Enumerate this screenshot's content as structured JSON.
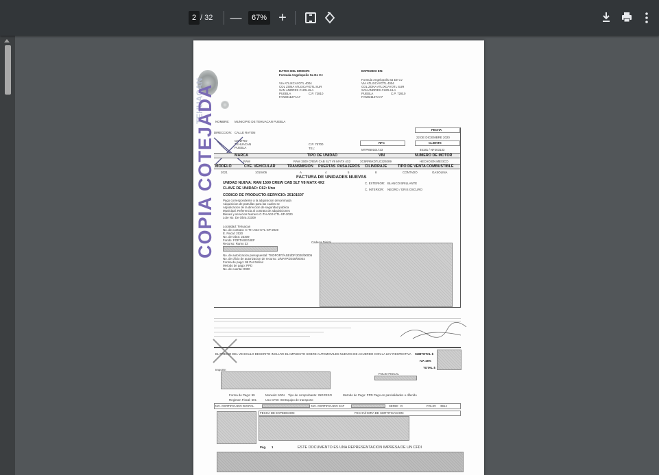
{
  "toolbar": {
    "page_current": "2",
    "page_total": "/ 32",
    "zoom_out": "—",
    "zoom_level": "67%",
    "zoom_in": "+",
    "icons": {
      "fit": "fit-to-page-icon",
      "rotate": "rotate-icon",
      "download": "download-icon",
      "print": "print-icon",
      "more": "more-vert-icon"
    }
  },
  "colors": {
    "toolbar_bg": "#323639",
    "viewer_bg": "#525659",
    "page_bg": "#fdfdfd",
    "stamp_purple": "#7a6bb5"
  },
  "doc": {
    "stamp": "COPIA COTEJADA",
    "emisor_title": "DATOS DEL EMISOR:",
    "emisor_name": "Formula Angelopolis Sa De Cv",
    "emisor_addr1": "VIA ATLIXCAYOTL 4004",
    "emisor_addr2": "COL ZONA ATLIXCAYOTL SUR",
    "emisor_addr3": "SAN ANDRES CHOLULA",
    "emisor_addr4": "PUEBLA",
    "emisor_cp": "C.P. 72810",
    "emisor_rfc": "FAN021127AA7",
    "expedido_title": "EXPEDIDO EN:",
    "expedido_name": "Formula Angelopolis Sa De Cv",
    "expedido_addr1": "VIA ATLIXCAYOTL 4004",
    "expedido_addr2": "COL ZONA ATLIXCAYOTL SUR",
    "expedido_addr3": "SAN ANDRES CHOLULA",
    "expedido_addr4": "PUEBLA",
    "expedido_cp": "C.P. 72810",
    "expedido_rfc": "FAN021127AA7",
    "nombre_label": "NOMBRE:",
    "nombre_value": "MUNICIPIO DE TEHUACAN PUEBLA",
    "direccion_label": "DIRECCION:",
    "direccion_value": "CALLE RAYON",
    "centro": "CENTRO",
    "tehuacan": "TEHUACAN",
    "puebla": "PUEBLA",
    "cp_value": "C.P. 75700",
    "tel_label": "TEL:",
    "fecha_label": "FECHA",
    "fecha_value": "22 DE DICIEMBRE 2020",
    "rfc_label": "RFC",
    "rfc_value": "MTP850101723",
    "cliente_label": "CLIENTE",
    "cliente_value": "45181 / NF203133",
    "hdr_marca": "MARCA",
    "hdr_tipo_unidad": "TIPO DE UNIDAD",
    "hdr_vin": "VIN",
    "hdr_motor": "NUMERO DE MOTOR",
    "val_marca": "RAM",
    "val_tipo_unidad": "RAM 1500 CREW CAB SLT V8 MATX 4X2",
    "val_vin": "3C6RR6KD7LG229289",
    "val_motor": "HECHO EN MEXICO",
    "hdr_modelo": "MODELO",
    "hdr_clave": "CVE. VEHICULAR",
    "hdr_transmision": "TRANSMISION",
    "hdr_puertas": "PUERTAS",
    "hdr_pasajeros": "PASAJEROS",
    "hdr_cilindraje": "CILINDRAJE",
    "hdr_tipo_venta": "TIPO DE VENTA",
    "hdr_combustible": "COMBUSTIBLE",
    "val_modelo": "2021",
    "val_clave": "1010406",
    "val_transmision": "A",
    "val_puertas": "4",
    "val_pasajeros": "5",
    "val_cilindraje": "8",
    "val_tipo_venta": "CONTADO",
    "val_combustible": "GASOLINA",
    "factura_title": "FACTURA DE UNIDADES NUEVAS",
    "unidad_line": "UNIDAD NUEVA: RAM 1500 CREW CAB SLT V8 MATX 4X2",
    "clave_unidad_line": "CLAVE DE UNIDAD:   C62: Uno",
    "codigo_line": "CODIGO DE PRODUCTO-SERVICIO: 25101507",
    "color_ext_label": "C. EXTERIOR:",
    "color_ext_value": "BLANCO BRILLANTE",
    "color_int_label": "C. INTERIOR:",
    "color_int_value": "NEGRO / GRIS OSCURO",
    "small_1": "Pago correspondiente a la adquisicion denominada",
    "small_2": "Adquisicion de patrullas para las cuales se",
    "small_3": "Adjudicacion de la direccion de seguridad publica",
    "small_4": "Municipal. Referencia al contrato de adquisiciones",
    "small_5": "Bienes y servicios Numero C-TH-ADJ-CTL-SP-2020",
    "small_6": "Lote No. De Obra 23309",
    "small_7": "Localidad: Tehuacan",
    "small_8": "No. de contrato: C-TH-ADJ-CTL-SP-2020",
    "small_9": "E. Fiscal: 2020",
    "small_10": "No. de Obra: 23309",
    "small_11": "Fondo: FORTASEG/IEF",
    "small_12": "Recurso: Ramo 33",
    "small_13": "No. de autorizacion presupuestal: TNDFORT/ASEI/DF/2020/00005",
    "small_14": "No. de oficio de autorizacion de recurso: 1/MATP/2020/00002",
    "small_15": "Forma de pago: 99 Por Definir",
    "small_16": "Metodo de pago: PPD",
    "small_17": "No. de cuenta: 0000",
    "cadena_label": "Cadena Digital",
    "importe_line": "EL PRECIO DEL VEHICULO DESCRITO INCLUYE EL IMPUESTO SOBRE AUTOMOVILES NUEVOS DE ACUERDO CON LA LEY RESPECTIVA",
    "subtotal_label": "SUBTOTAL $",
    "iva_label": "IVA 16%",
    "total_label": "TOTAL $",
    "importe_label": "Importe:",
    "folio_fiscal_label": "FOLIO FISCAL",
    "forma_pago": "Forma de Pago: 99",
    "moneda": "Moneda: MXN",
    "tipo_comprobante": "Tipo de comprobante: INGRESO",
    "metodo_pago": "Metodo de Pago: PPD Pago en parcialidades o diferido",
    "regimen": "Regimen Fiscal: 601",
    "uso_cfdi": "Uso CFDI: I03 Equipo de transporte",
    "no_cert_label": "NO. CERTIFICADO DIGITAL",
    "no_cert_sat_label": "NO. CERTIFICADO SAT",
    "serie_label": "SERIE:",
    "serie_value": "D",
    "folio_label": "FOLIO:",
    "folio_value": "3914",
    "fecha_exp_label": "FECHA DE EXPEDICION:",
    "fecha_cert_label": "FECHA/HORA DE CERTIFICACION:",
    "pag_label": "Pág.",
    "pag_value": "1",
    "cfdi_line": "ESTE DOCUMENTO ES UNA REPRESENTACION IMPRESA DE UN CFDI"
  }
}
